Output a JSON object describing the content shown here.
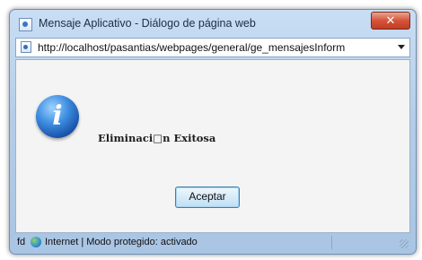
{
  "window": {
    "title": "Mensaje Aplicativo - Diálogo de página web",
    "close_label": "✕"
  },
  "address_bar": {
    "url": "http://localhost/pasantias/webpages/general/ge_mensajesInform"
  },
  "dialog": {
    "message": "Eliminaci□n Exitosa",
    "info_glyph": "i",
    "accept_label": "Aceptar"
  },
  "status_bar": {
    "prefix": "fd",
    "zone_text": "Internet | Modo protegido: activado"
  },
  "colors": {
    "frame": "#b3cde9",
    "close_button": "#d5543a",
    "info_icon": "#3d8de0"
  },
  "icons": [
    "app-icon",
    "page-icon",
    "dropdown-arrow-icon",
    "info-icon",
    "globe-icon",
    "resize-grip-icon"
  ]
}
